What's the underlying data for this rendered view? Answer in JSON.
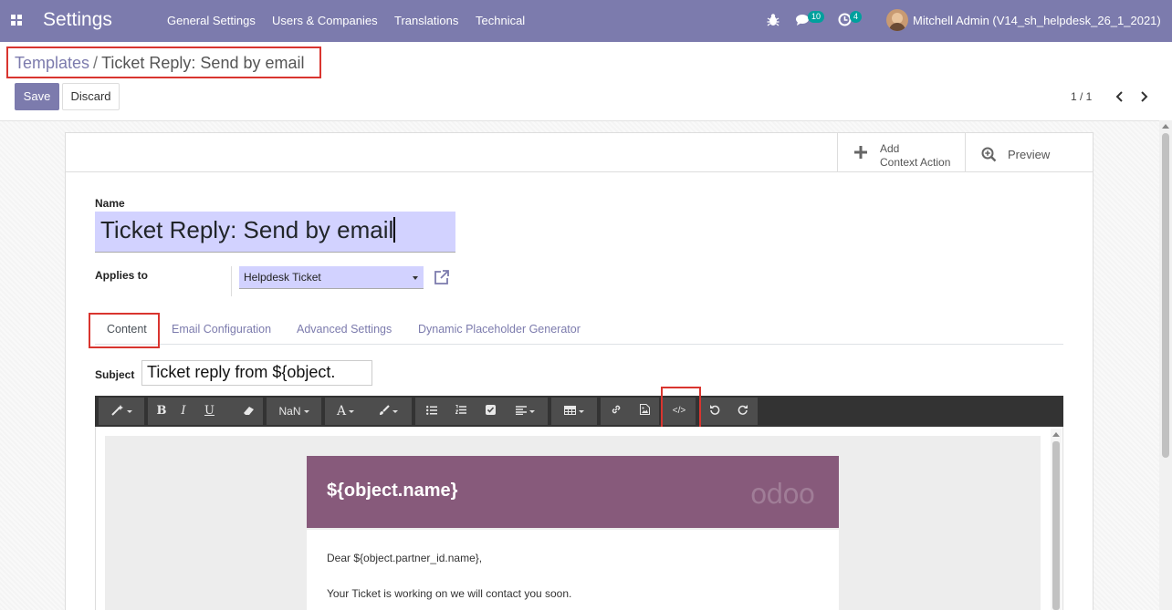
{
  "navbar": {
    "app_title": "Settings",
    "menus": [
      "General Settings",
      "Users & Companies",
      "Translations",
      "Technical"
    ],
    "messages_count": "10",
    "activities_count": "4",
    "user_label": "Mitchell Admin (V14_sh_helpdesk_26_1_2021)"
  },
  "breadcrumb": {
    "parent": "Templates",
    "separator": "/",
    "current": "Ticket Reply: Send by email"
  },
  "actions": {
    "save": "Save",
    "discard": "Discard"
  },
  "pager": {
    "value": "1 / 1"
  },
  "button_box": {
    "add_context_line1": "Add",
    "add_context_line2": "Context Action",
    "preview": "Preview"
  },
  "form": {
    "name_label": "Name",
    "name_value": "Ticket Reply: Send by email",
    "applies_to_label": "Applies to",
    "applies_to_value": "Helpdesk Ticket",
    "subject_label": "Subject",
    "subject_value": "Ticket reply from ${object."
  },
  "tabs": [
    "Content",
    "Email Configuration",
    "Advanced Settings",
    "Dynamic Placeholder Generator"
  ],
  "toolbar": {
    "font_size": "NaN",
    "bold": "B",
    "italic": "I",
    "underline": "U",
    "font_color": "A",
    "codeview": "</>"
  },
  "email": {
    "header_title": "${object.name}",
    "logo_text": "odoo",
    "greeting": "Dear ${object.partner_id.name},",
    "body_line": "Your Ticket is working on we will contact you soon."
  },
  "colors": {
    "brand": "#7c7bad",
    "email_header": "#875a7b",
    "highlight": "#d9352f"
  }
}
